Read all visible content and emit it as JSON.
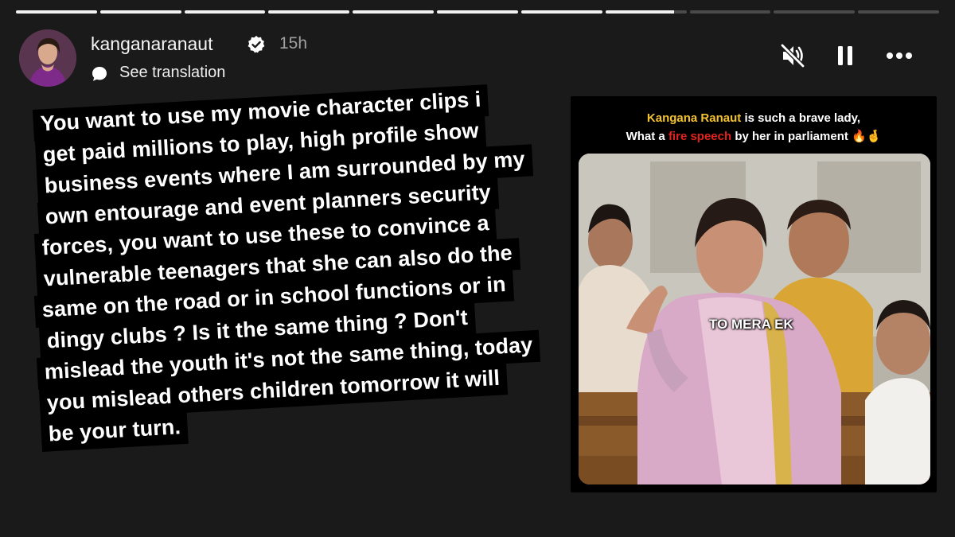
{
  "story": {
    "progress": [
      1,
      1,
      1,
      1,
      1,
      1,
      1,
      0.85,
      0,
      0,
      0
    ]
  },
  "header": {
    "username": "kanganaranaut",
    "time": "15h",
    "translation": "See translation",
    "avatar_icon": "profile-avatar",
    "verified_icon": "verified-badge-icon",
    "controls": [
      "mute-icon",
      "pause-icon",
      "more-icon"
    ]
  },
  "post_text": [
    "You want to use my movie character clips i",
    "get paid millions to play, high profile show",
    "business events where I am surrounded by my",
    "own entourage and event planners security",
    "forces, you want to use these to convince a",
    "vulnerable teenagers that she can also do the",
    "same on the road or in school functions or in",
    "dingy clubs ? Is it the same thing ? Don't",
    "mislead the youth it's not the same thing, today",
    "you mislead others children tomorrow it will",
    "be your turn."
  ],
  "shared_post": {
    "caption_name": "Kangana Ranaut",
    "caption_rest1": " is such a brave lady,",
    "caption_start2": "What a ",
    "caption_hl": "fire speech",
    "caption_end2": " by her in parliament ",
    "caption_emoji": "🔥🤞",
    "overlay": "TO MERA EK"
  },
  "colors": {
    "background": "#1a1a1a",
    "highlight_yellow": "#f2c230",
    "highlight_red": "#e0231d"
  }
}
